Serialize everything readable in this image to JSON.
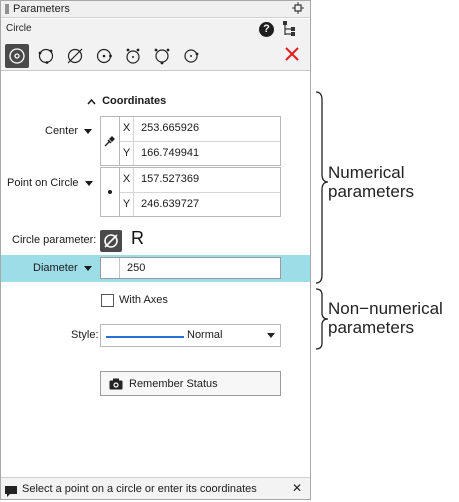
{
  "window": {
    "title": "Parameters"
  },
  "header": {
    "command_name": "Circle"
  },
  "toolbar": {
    "tools": [
      {
        "icon": "circle-center-radius-icon",
        "active": true
      },
      {
        "icon": "circle-three-points-icon",
        "active": false
      },
      {
        "icon": "circle-tangent-icon",
        "active": false
      },
      {
        "icon": "circle-two-points-icon",
        "active": false
      },
      {
        "icon": "circle-tangent-two-icon",
        "active": false
      },
      {
        "icon": "circle-tangent-three-icon",
        "active": false
      },
      {
        "icon": "circle-arc-icon",
        "active": false
      }
    ],
    "accent_close": "#e02020"
  },
  "coordinates": {
    "header": "Coordinates",
    "center": {
      "label": "Center",
      "x_axis": "X",
      "x": "253.665926",
      "y_axis": "Y",
      "y": "166.749941"
    },
    "point_on_circle": {
      "label": "Point on Circle",
      "x_axis": "X",
      "x": "157.527369",
      "y_axis": "Y",
      "y": "246.639727"
    }
  },
  "circle_parameter": {
    "label": "Circle parameter:",
    "r_label": "R"
  },
  "diameter": {
    "label": "Diameter",
    "value": "250",
    "highlight_color": "#9ddde8"
  },
  "with_axes": {
    "label": "With Axes",
    "checked": false
  },
  "style": {
    "label": "Style:",
    "value": "Normal",
    "line_color": "#2a6fd6"
  },
  "remember": {
    "label": "Remember Status"
  },
  "status": {
    "text": "Select a point on a circle or enter its coordinates"
  },
  "annotations": {
    "numerical": "Numerical\nparameters",
    "non_numerical": "Non−numerical\nparameters"
  }
}
